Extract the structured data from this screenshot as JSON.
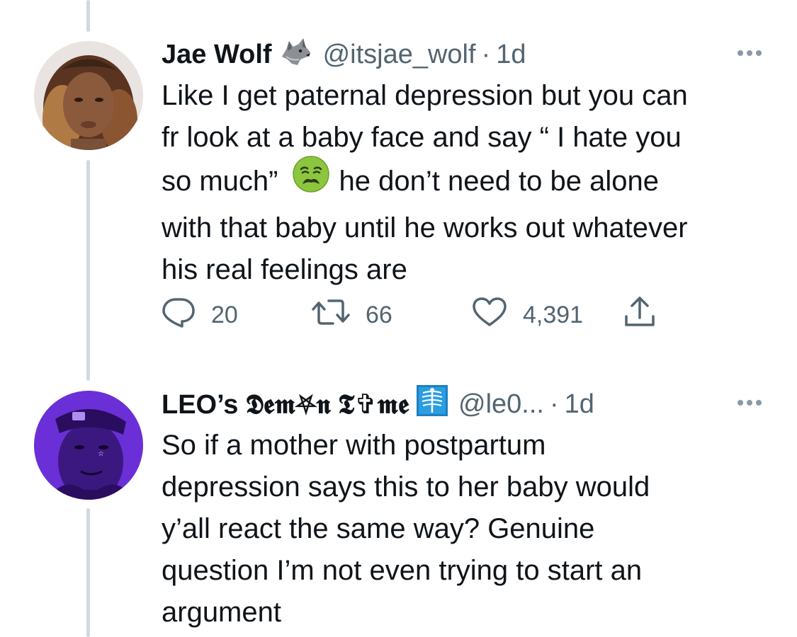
{
  "tweets": [
    {
      "display_name": "Jae Wolf",
      "badge_icon": "wolf-emoji-icon",
      "handle": "@itsjae_wolf",
      "separator": "·",
      "time": "1d",
      "text_lines": [
        "Like I get paternal depression but you can",
        "fr look at a baby face and say “ I hate you",
        "so much”",
        "he don’t need to be alone",
        "with that baby until he works out whatever",
        "his real feelings are"
      ],
      "inline_emoji": "nauseated-face-icon",
      "actions": {
        "replies": "20",
        "retweets": "66",
        "likes": "4,391"
      }
    },
    {
      "display_name": "LEO’s 𝕯𝖊𝖒⛧𝖓 𝕿✞𝖒𝖊",
      "badge_icon": "xray-emoji-icon",
      "handle": "@le0...",
      "separator": "·",
      "time": "1d",
      "text_lines": [
        "So if a mother with postpartum",
        "depression says this to her baby would",
        "y’all react the same way? Genuine",
        "question I’m not even trying to start an",
        "argument"
      ]
    }
  ],
  "colors": {
    "text": "#0f1419",
    "secondary": "#536471",
    "thread_line": "#cfd9de"
  }
}
